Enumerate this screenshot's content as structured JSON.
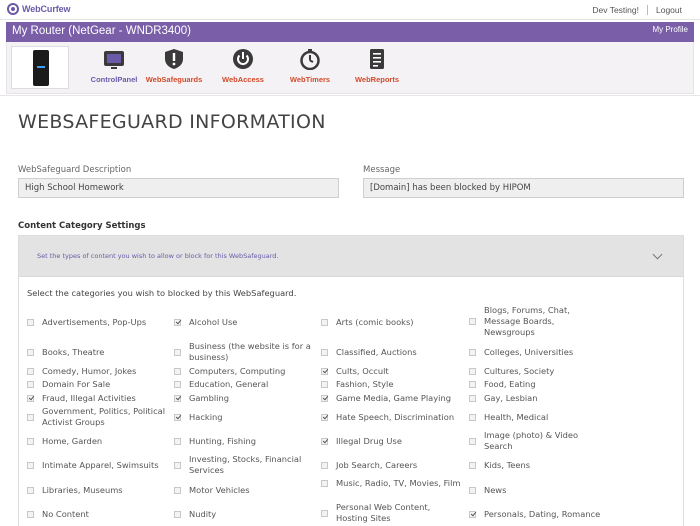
{
  "brand": {
    "name": "WebCurfew"
  },
  "topnav": {
    "user": "Dev Testing!",
    "logout": "Logout"
  },
  "router": {
    "title": "My Router (NetGear - WNDR3400)",
    "profile_link": "My Profile"
  },
  "nav": [
    {
      "label": "ControlPanel",
      "icon": "control-panel-icon"
    },
    {
      "label": "WebSafeguards",
      "icon": "shield-icon"
    },
    {
      "label": "WebAccess",
      "icon": "power-icon"
    },
    {
      "label": "WebTimers",
      "icon": "stopwatch-icon"
    },
    {
      "label": "WebReports",
      "icon": "report-icon"
    }
  ],
  "page": {
    "title": "WEBSAFEGUARD INFORMATION"
  },
  "form": {
    "description_label": "WebSafeguard Description",
    "description_value": "High School Homework",
    "message_label": "Message",
    "message_value": "[Domain] has been blocked by HIPOM"
  },
  "content": {
    "section_title": "Content Category Settings",
    "panel_header": "Set the types of content you wish to allow or block for this WebSafeguard.",
    "instruction": "Select the categories you wish to blocked by this WebSafeguard."
  },
  "categories": [
    {
      "label": "Advertisements, Pop-Ups",
      "checked": false
    },
    {
      "label": "Alcohol Use",
      "checked": true
    },
    {
      "label": "Arts (comic books)",
      "checked": false
    },
    {
      "label": "Blogs, Forums, Chat, Message Boards, Newsgroups",
      "checked": false
    },
    {
      "label": "Books, Theatre",
      "checked": false
    },
    {
      "label": "Business (the website is for a business)",
      "checked": false
    },
    {
      "label": "Classified, Auctions",
      "checked": false
    },
    {
      "label": "Colleges, Universities",
      "checked": false
    },
    {
      "label": "Comedy, Humor, Jokes",
      "checked": false
    },
    {
      "label": "Computers, Computing",
      "checked": false
    },
    {
      "label": "Cults, Occult",
      "checked": true
    },
    {
      "label": "Cultures, Society",
      "checked": false
    },
    {
      "label": "Domain For Sale",
      "checked": false
    },
    {
      "label": "Education, General",
      "checked": false
    },
    {
      "label": "Fashion, Style",
      "checked": false
    },
    {
      "label": "Food, Eating",
      "checked": false
    },
    {
      "label": "Fraud, Illegal Activities",
      "checked": true
    },
    {
      "label": "Gambling",
      "checked": true
    },
    {
      "label": "Game Media, Game Playing",
      "checked": true
    },
    {
      "label": "Gay, Lesbian",
      "checked": false
    },
    {
      "label": "Government, Politics, Political Activist Groups",
      "checked": false
    },
    {
      "label": "Hacking",
      "checked": true
    },
    {
      "label": "Hate Speech, Discrimination",
      "checked": true
    },
    {
      "label": "Health, Medical",
      "checked": false
    },
    {
      "label": "Home, Garden",
      "checked": false
    },
    {
      "label": "Hunting, Fishing",
      "checked": false
    },
    {
      "label": "Illegal Drug Use",
      "checked": true
    },
    {
      "label": "Image (photo) & Video Search",
      "checked": false
    },
    {
      "label": "Intimate Apparel, Swimsuits",
      "checked": false
    },
    {
      "label": "Investing, Stocks, Financial Services",
      "checked": false
    },
    {
      "label": "Job Search, Careers",
      "checked": false
    },
    {
      "label": "Kids, Teens",
      "checked": false
    },
    {
      "label": "Libraries, Museums",
      "checked": false
    },
    {
      "label": "Motor Vehicles",
      "checked": false
    },
    {
      "label": "Music, Radio, TV, Movies, Film",
      "checked": false
    },
    {
      "label": "News",
      "checked": false
    },
    {
      "label": "No Content",
      "checked": false
    },
    {
      "label": "Nudity",
      "checked": false
    },
    {
      "label": "Personal Web Content, Hosting Sites",
      "checked": false
    },
    {
      "label": "Personals, Dating, Romance",
      "checked": true
    }
  ],
  "colors": {
    "brand": "#7a5ea8",
    "accent": "#d24a2a"
  }
}
